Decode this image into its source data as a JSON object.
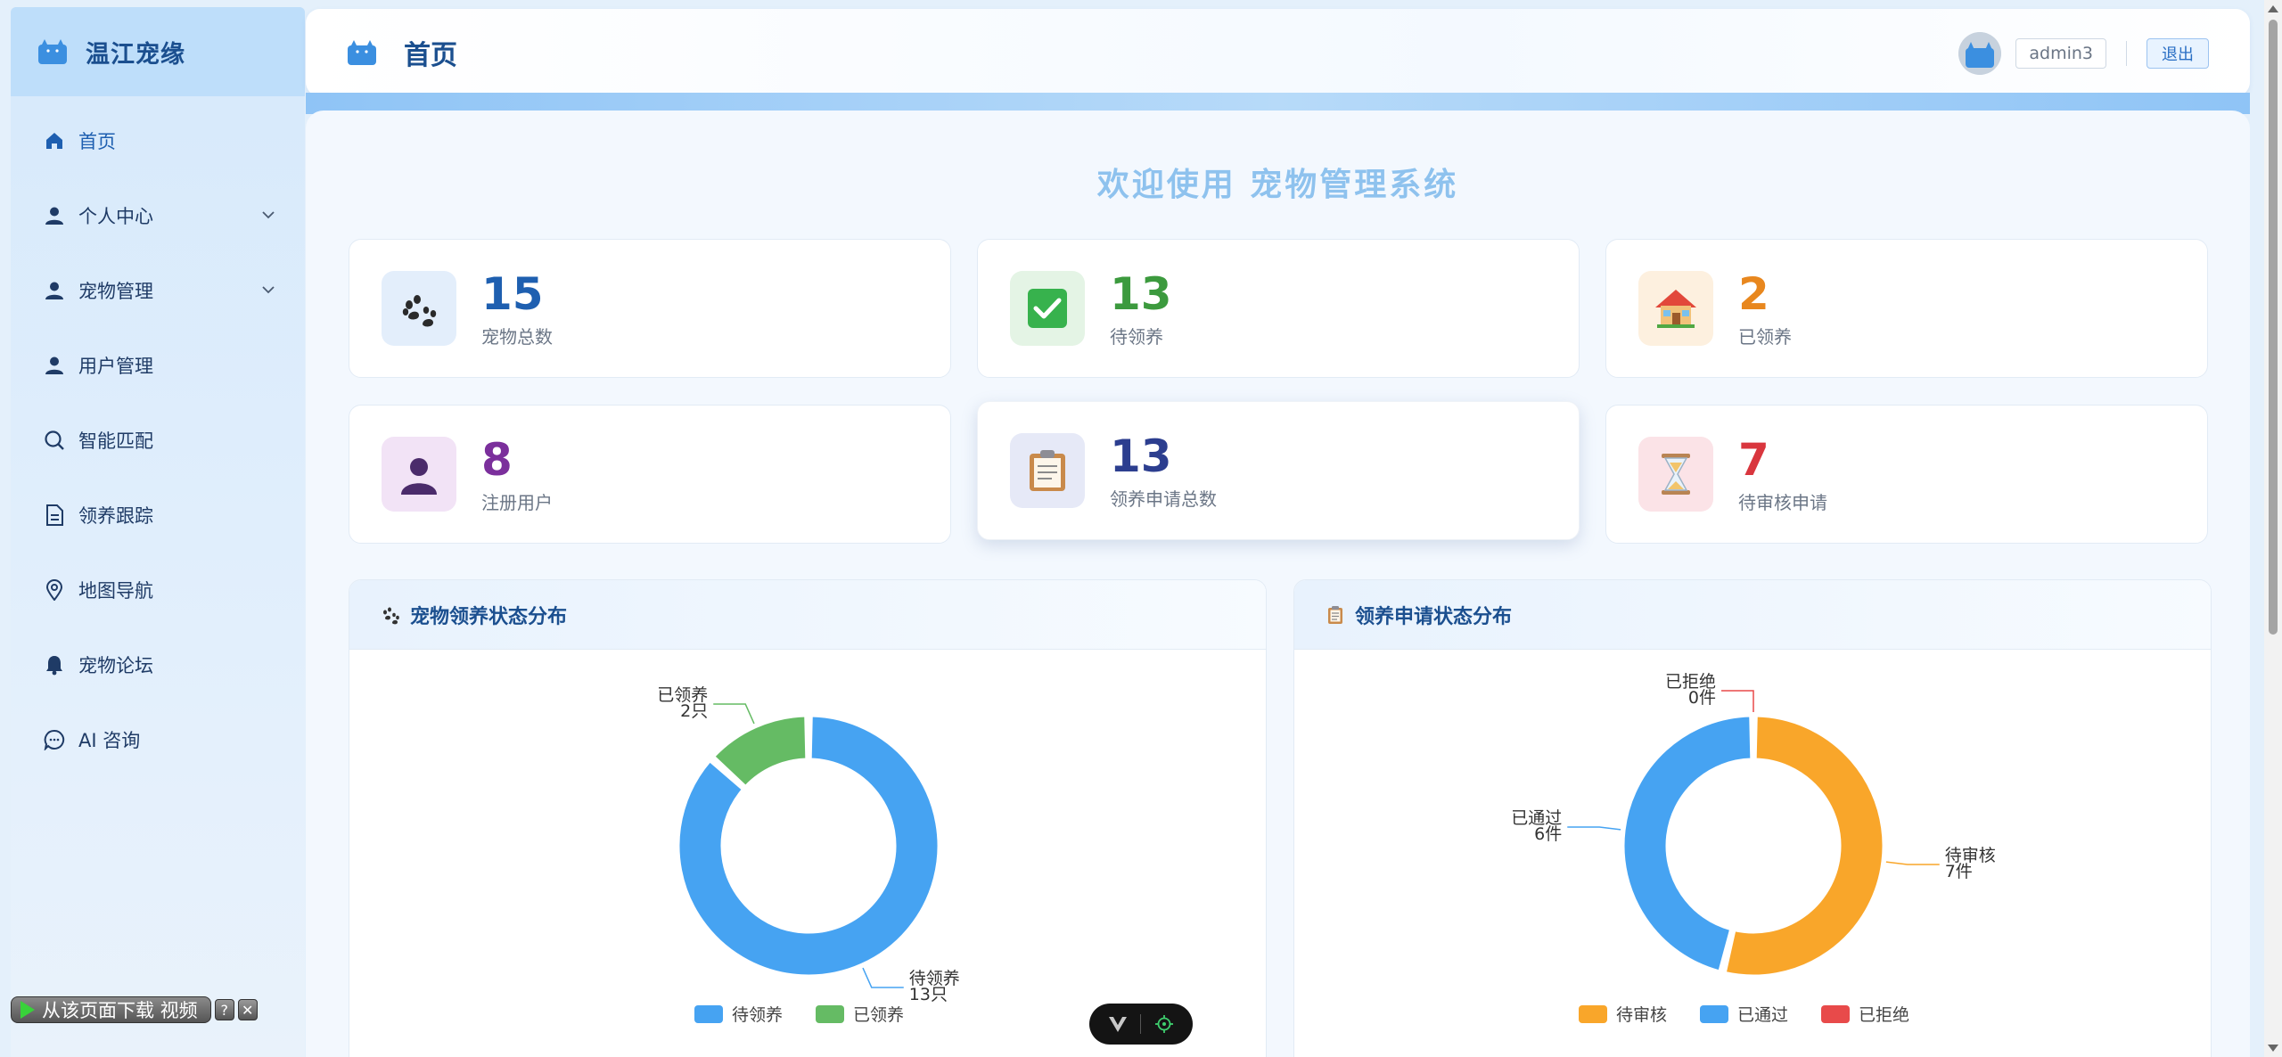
{
  "app": {
    "brand": "温江宠缘"
  },
  "header": {
    "page_title": "首页",
    "username": "admin3",
    "logout": "退出"
  },
  "sidebar": {
    "items": [
      {
        "label": "首页",
        "icon": "home-icon"
      },
      {
        "label": "个人中心",
        "icon": "user-icon",
        "expandable": true
      },
      {
        "label": "宠物管理",
        "icon": "user-icon",
        "expandable": true
      },
      {
        "label": "用户管理",
        "icon": "user-icon"
      },
      {
        "label": "智能匹配",
        "icon": "search-icon"
      },
      {
        "label": "领养跟踪",
        "icon": "document-icon"
      },
      {
        "label": "地图导航",
        "icon": "map-pin-icon"
      },
      {
        "label": "宠物论坛",
        "icon": "bell-icon"
      },
      {
        "label": "AI 咨询",
        "icon": "chat-icon"
      }
    ]
  },
  "welcome": "欢迎使用 宠物管理系统",
  "stats": [
    {
      "value": "15",
      "label": "宠物总数",
      "color": "#1e5fb0",
      "icon": "paw-icon"
    },
    {
      "value": "13",
      "label": "待领养",
      "color": "#3c9a3e",
      "icon": "check-icon"
    },
    {
      "value": "2",
      "label": "已领养",
      "color": "#e8871e",
      "icon": "house-icon"
    },
    {
      "value": "8",
      "label": "注册用户",
      "color": "#7b2f9c",
      "icon": "person-icon"
    },
    {
      "value": "13",
      "label": "领养申请总数",
      "color": "#2c3e8f",
      "icon": "clipboard-icon"
    },
    {
      "value": "7",
      "label": "待审核申请",
      "color": "#d9363e",
      "icon": "hourglass-icon"
    }
  ],
  "charts": {
    "pet_status_title": "宠物领养状态分布",
    "application_status_title": "领养申请状态分布"
  },
  "chart_data": [
    {
      "type": "pie",
      "title": "宠物领养状态分布",
      "categories": [
        "待领养",
        "已领养"
      ],
      "values": [
        13,
        2
      ],
      "data_labels": [
        "待领养\n13只",
        "已领养\n2只"
      ],
      "colors": [
        "#46a3f2",
        "#65bb64"
      ],
      "donut": true,
      "legend": "bottom"
    },
    {
      "type": "pie",
      "title": "领养申请状态分布",
      "categories": [
        "待审核",
        "已通过",
        "已拒绝"
      ],
      "values": [
        7,
        6,
        0
      ],
      "data_labels": [
        "待审核\n7件",
        "已通过\n6件",
        "已拒绝\n0件"
      ],
      "colors": [
        "#f9a62a",
        "#46a3f2",
        "#e84a4a"
      ],
      "donut": true,
      "legend": "bottom"
    }
  ],
  "download_bar": {
    "label": "从该页面下载 视频",
    "help": "?",
    "close": "✕"
  }
}
